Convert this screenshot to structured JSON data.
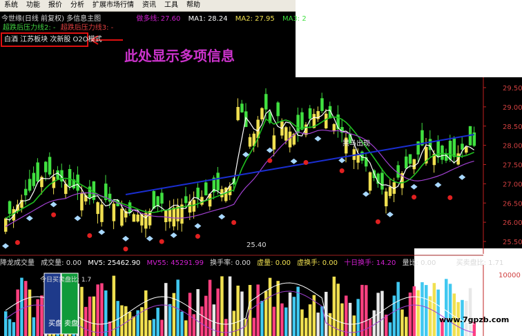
{
  "menu": [
    "系统",
    "功能",
    "报价",
    "分析",
    "扩展市场行情",
    "资讯",
    "工具",
    "帮助"
  ],
  "chart_header": {
    "title": "今世缘(日线 前复权) 多信息主图",
    "ind_label": "做多线:",
    "ind_value": "27.60",
    "ma1": "MA1: 28.24",
    "ma2": "MA2: 27.95",
    "ma3": "MA3: 2"
  },
  "line2": {
    "a": "超跌后压力线2: -",
    "b": "超跌后压力线3: -"
  },
  "info_box": "白酒 江苏板块 次新股 O2O模式",
  "annotation": "此处显示多项信息",
  "price_axis": [
    "29.50",
    "29.00",
    "28.50",
    "28.00",
    "27.50",
    "27.00",
    "26.50",
    "26.00",
    "25.50"
  ],
  "price_labels": {
    "low": "25.40",
    "signal": "黑马出现"
  },
  "volume_header": {
    "title": "降龙成交量",
    "vol": "成交量: 0.00",
    "mv5": "MV5: 25462.90",
    "mv55": "MV55: 45291.99",
    "turnover": "换手率: 0.00",
    "virtual": "虚量: 0.00",
    "vturn": "虚换手: 0.00",
    "ten": "十日换手: 14.20",
    "ratio": "量比: 0.00",
    "bsratio": "买卖盘比: 1.71"
  },
  "volume_axis": "10000",
  "bs_indicator": {
    "label": "今日买卖盘比: 1.7",
    "buy": "买盘",
    "sell": "卖盘"
  },
  "watermark": "www.7gpzb.com",
  "colors": {
    "up": "#f0e050",
    "down": "#40e040",
    "blue": "#1a2ed0",
    "purple": "#a040d0",
    "white": "#ffffff",
    "green_line": "#20c020",
    "red_axis": "#c02020"
  }
}
